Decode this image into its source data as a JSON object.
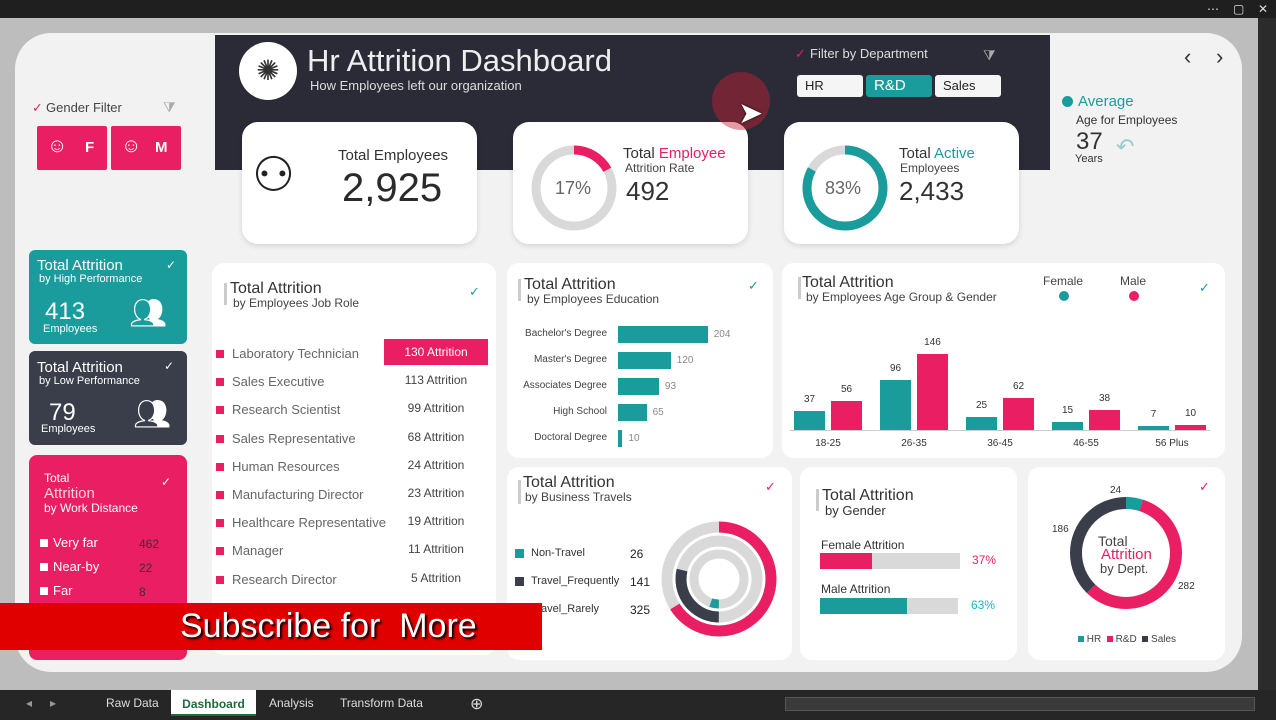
{
  "window": {
    "more_icon": "ellipsis-icon",
    "restore_icon": "restore-icon",
    "close_icon": "close-icon"
  },
  "header": {
    "title": "Hr Attrition Dashboard",
    "subtitle": "How Employees left our organization",
    "logo_icon": "network-hub-icon"
  },
  "dept_filter": {
    "label": "Filter by Department",
    "options": [
      "HR",
      "R&D",
      "Sales"
    ],
    "selected": "R&D"
  },
  "gender_filter": {
    "label": "Gender Filter",
    "options": [
      "F",
      "M"
    ]
  },
  "nav": {
    "prev": "‹",
    "next": "›"
  },
  "kpis": {
    "total_employees": {
      "label": "Total Employees",
      "value": "2,925"
    },
    "attrition_rate": {
      "label_a": "Total ",
      "label_b": "Employee",
      "label_c": "Attrition Rate",
      "percent": "17%",
      "value": "492",
      "fraction": 0.17
    },
    "active": {
      "label_a": "Total ",
      "label_b": "Active",
      "label_c": "Employees",
      "percent": "83%",
      "value": "2,433",
      "fraction": 0.83
    }
  },
  "average_age": {
    "title": "Average",
    "label": "Age for Employees",
    "value": "37",
    "unit": "Years"
  },
  "high_perf": {
    "title": "Total Attrition",
    "sub": "by High Performance",
    "value": "413",
    "unit": "Employees"
  },
  "low_perf": {
    "title": "Total Attrition",
    "sub": "by Low Performance",
    "value": "79",
    "unit": "Employees"
  },
  "work_distance": {
    "title_a": "Total",
    "title_b": "Attrition",
    "sub": "by Work Distance",
    "items": [
      {
        "label": "Very far",
        "value": "462"
      },
      {
        "label": "Near-by",
        "value": "22"
      },
      {
        "label": "Far",
        "value": "8"
      }
    ]
  },
  "job_role": {
    "title": "Total Attrition",
    "sub": "by Employees Job Role",
    "items": [
      {
        "role": "Laboratory Technician",
        "value": "130 Attrition"
      },
      {
        "role": "Sales Executive",
        "value": "113 Attrition"
      },
      {
        "role": "Research Scientist",
        "value": "99 Attrition"
      },
      {
        "role": "Sales Representative",
        "value": "68 Attrition"
      },
      {
        "role": "Human Resources",
        "value": "24 Attrition"
      },
      {
        "role": "Manufacturing Director",
        "value": "23 Attrition"
      },
      {
        "role": "Healthcare Representative",
        "value": "19 Attrition"
      },
      {
        "role": "Manager",
        "value": "11 Attrition"
      },
      {
        "role": "Research Director",
        "value": "5 Attrition"
      }
    ]
  },
  "banner": {
    "text": "Subscribe for  More"
  },
  "business_travel": {
    "title": "Total Attrition",
    "sub": "by Business Travels",
    "items": [
      {
        "label": "Non-Travel",
        "value": "26",
        "color": "#1a9c9c"
      },
      {
        "label": "Travel_Frequently",
        "value": "141",
        "color": "#3a3d4a"
      },
      {
        "label": "Travel_Rarely",
        "value": "325",
        "color": "#e91e63"
      }
    ]
  },
  "gender": {
    "title": "Total Attrition",
    "sub": "by Gender",
    "female": {
      "label": "Female Attrition",
      "percent": "37%",
      "fraction": 0.37
    },
    "male": {
      "label": "Male Attrition",
      "percent": "63%",
      "fraction": 0.63
    }
  },
  "dept_donut": {
    "center_a": "Total",
    "center_b": "Attrition",
    "center_c": "by Dept.",
    "legend": [
      "HR",
      "R&D",
      "Sales"
    ]
  },
  "colors": {
    "teal": "#1a9c9c",
    "pink": "#e91e63",
    "dark": "#3a3d4a",
    "gray": "#d9d9d9"
  },
  "chart_data": [
    {
      "type": "bar",
      "title": "Total Attrition",
      "subtitle": "by Employees Education",
      "orientation": "horizontal",
      "categories": [
        "Bachelor's Degree",
        "Master's Degree",
        "Associates Degree",
        "High School",
        "Doctoral Degree"
      ],
      "values": [
        204,
        120,
        93,
        65,
        10
      ]
    },
    {
      "type": "bar",
      "title": "Total Attrition",
      "subtitle": "by Employees Age Group & Gender",
      "categories": [
        "18-25",
        "26-35",
        "36-45",
        "46-55",
        "56 Plus"
      ],
      "series": [
        {
          "name": "Female",
          "values": [
            37,
            96,
            25,
            15,
            7
          ]
        },
        {
          "name": "Male",
          "values": [
            56,
            146,
            62,
            38,
            10
          ]
        }
      ]
    },
    {
      "type": "pie",
      "title": "Total Attrition by Dept.",
      "categories": [
        "HR",
        "R&D",
        "Sales"
      ],
      "values": [
        24,
        282,
        186
      ]
    }
  ],
  "sheet_tabs": [
    "Raw Data",
    "Dashboard",
    "Analysis",
    "Transform Data"
  ],
  "active_tab": "Dashboard"
}
